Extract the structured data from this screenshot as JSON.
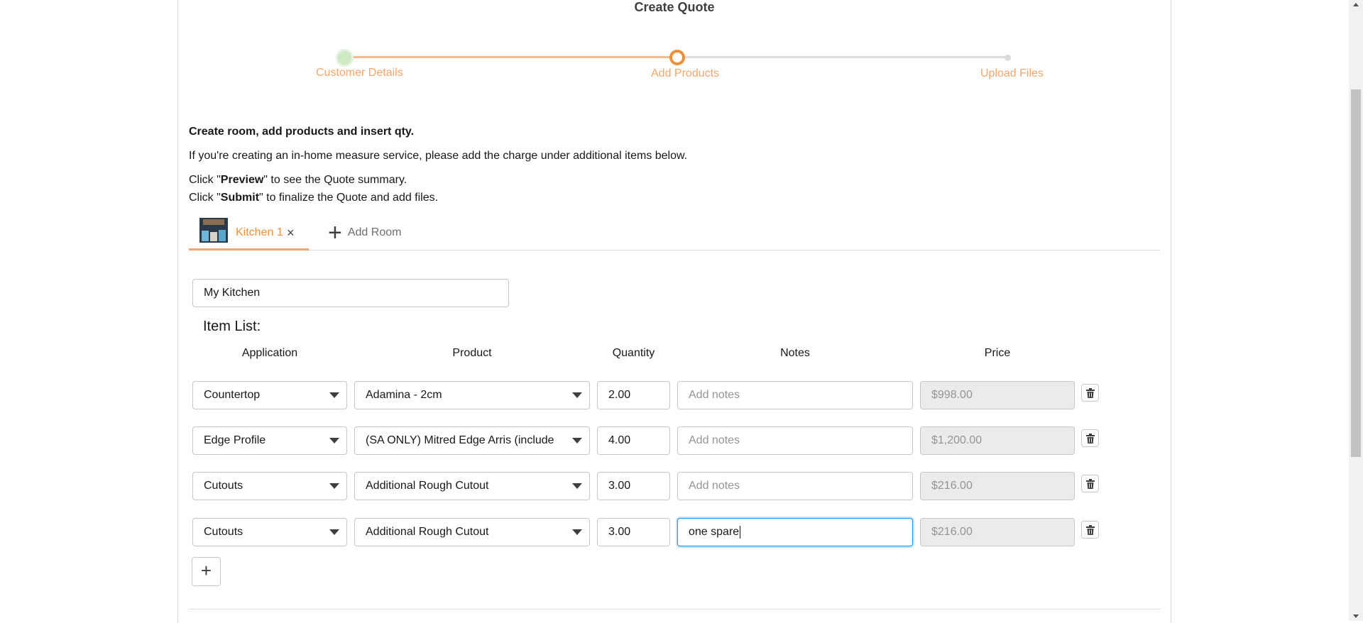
{
  "page": {
    "title": "Create Quote"
  },
  "progress": {
    "steps": [
      {
        "label": "Customer Details",
        "state": "complete"
      },
      {
        "label": "Add Products",
        "state": "active"
      },
      {
        "label": "Upload Files",
        "state": "upcoming"
      }
    ]
  },
  "instructions": {
    "heading": "Create room, add products and insert qty.",
    "line1": "If you're creating an in-home measure service, please add the charge under additional items below.",
    "preview_prefix": "Click \"",
    "preview_word": "Preview",
    "preview_suffix": "\" to see the Quote summary.",
    "submit_prefix": "Click \"",
    "submit_word": "Submit",
    "submit_suffix": "\" to finalize the Quote and add files."
  },
  "tabs": {
    "rooms": [
      {
        "label": "Kitchen 1",
        "close": "×"
      }
    ],
    "add_room_icon": "+",
    "add_room_label": "Add Room"
  },
  "room": {
    "name_value": "My Kitchen"
  },
  "item_list": {
    "title": "Item List:",
    "headers": {
      "application": "Application",
      "product": "Product",
      "quantity": "Quantity",
      "notes": "Notes",
      "price": "Price"
    },
    "notes_placeholder": "Add notes",
    "rows": [
      {
        "application": "Countertop",
        "product": "Adamina - 2cm",
        "quantity": "2.00",
        "notes": "",
        "price": "$998.00"
      },
      {
        "application": "Edge Profile",
        "product": "(SA ONLY) Mitred Edge Arris (include",
        "quantity": "4.00",
        "notes": "",
        "price": "$1,200.00"
      },
      {
        "application": "Cutouts",
        "product": "Additional Rough Cutout",
        "quantity": "3.00",
        "notes": "",
        "price": "$216.00"
      },
      {
        "application": "Cutouts",
        "product": "Additional Rough Cutout",
        "quantity": "3.00",
        "notes": "one spare",
        "price": "$216.00"
      }
    ],
    "add_row_icon": "+"
  },
  "colors": {
    "accent": "#f08e35",
    "accent_light": "#f5a56a",
    "complete": "#cfe9c5",
    "focus": "#1b96ff"
  }
}
